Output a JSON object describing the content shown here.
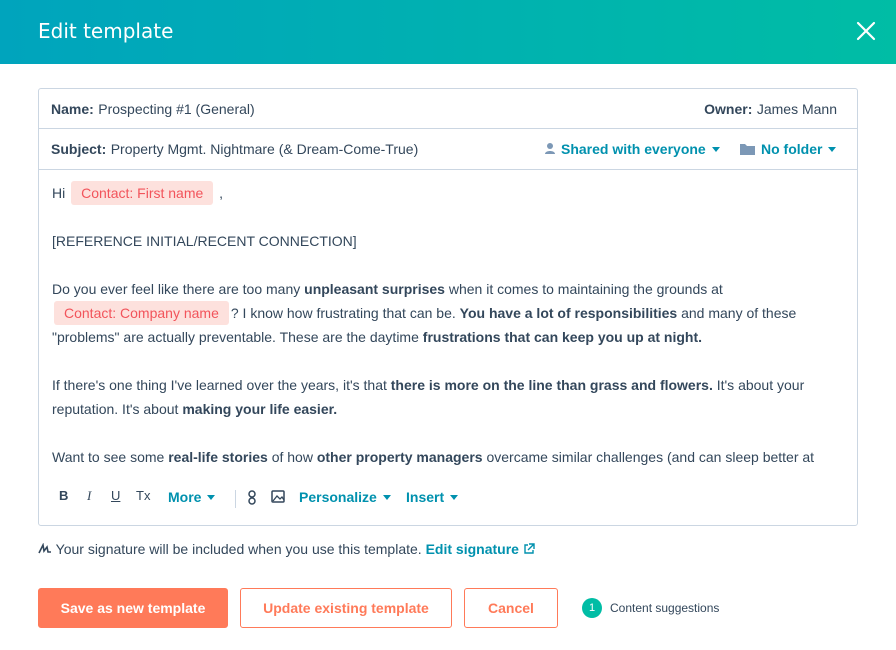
{
  "header": {
    "title": "Edit template",
    "close_icon": "close-icon"
  },
  "template": {
    "name_label": "Name:",
    "name_value": "Prospecting #1 (General)",
    "owner_label": "Owner:",
    "owner_value": "James Mann",
    "subject_label": "Subject:",
    "subject_value": "Property Mgmt. Nightmare (& Dream-Come-True)",
    "sharing": "Shared with everyone",
    "folder": "No folder"
  },
  "body": {
    "greeting_hi": "Hi",
    "token_first_name": "Contact: First name",
    "greeting_comma": ",",
    "reference": "[REFERENCE INITIAL/RECENT CONNECTION]",
    "p1_a": "Do you ever feel like there are too many",
    "p1_b": "unpleasant surprises",
    "p1_c": "when it comes to maintaining the grounds at",
    "token_company": "Contact: Company name",
    "p1_d": "? I know how frustrating that can be.",
    "p1_e": "You have a lot of responsibilities",
    "p1_f": "and many of these \"problems\" are actually preventable. These are the daytime",
    "p1_g": "frustrations that can keep you up at night.",
    "p2_a": "If there's one thing I've learned over the years, it's that",
    "p2_b": "there is more on the line than grass and flowers.",
    "p2_c": "It's about your reputation. It's about",
    "p2_d": "making your life easier.",
    "p3_a": "Want to see some",
    "p3_b": "real-life stories",
    "p3_c": "of how",
    "p3_d": "other property managers",
    "p3_e": "overcame similar challenges (and can sleep better at night)? Check these out:"
  },
  "toolbar": {
    "bold": "B",
    "italic": "I",
    "underline": "U",
    "clear_format": "Tx",
    "more": "More",
    "personalize": "Personalize",
    "insert": "Insert"
  },
  "signature": {
    "text": "Your signature will be included when you use this template.",
    "link": "Edit signature"
  },
  "actions": {
    "save_new": "Save as new template",
    "update": "Update existing template",
    "cancel": "Cancel",
    "suggestions_count": "1",
    "suggestions_label": "Content suggestions"
  },
  "colors": {
    "header_start": "#00a4bd",
    "header_end": "#00bda5",
    "accent": "#ff7a59",
    "link": "#0091ae",
    "token_bg": "#fde1dd",
    "token_text": "#f2545b"
  }
}
